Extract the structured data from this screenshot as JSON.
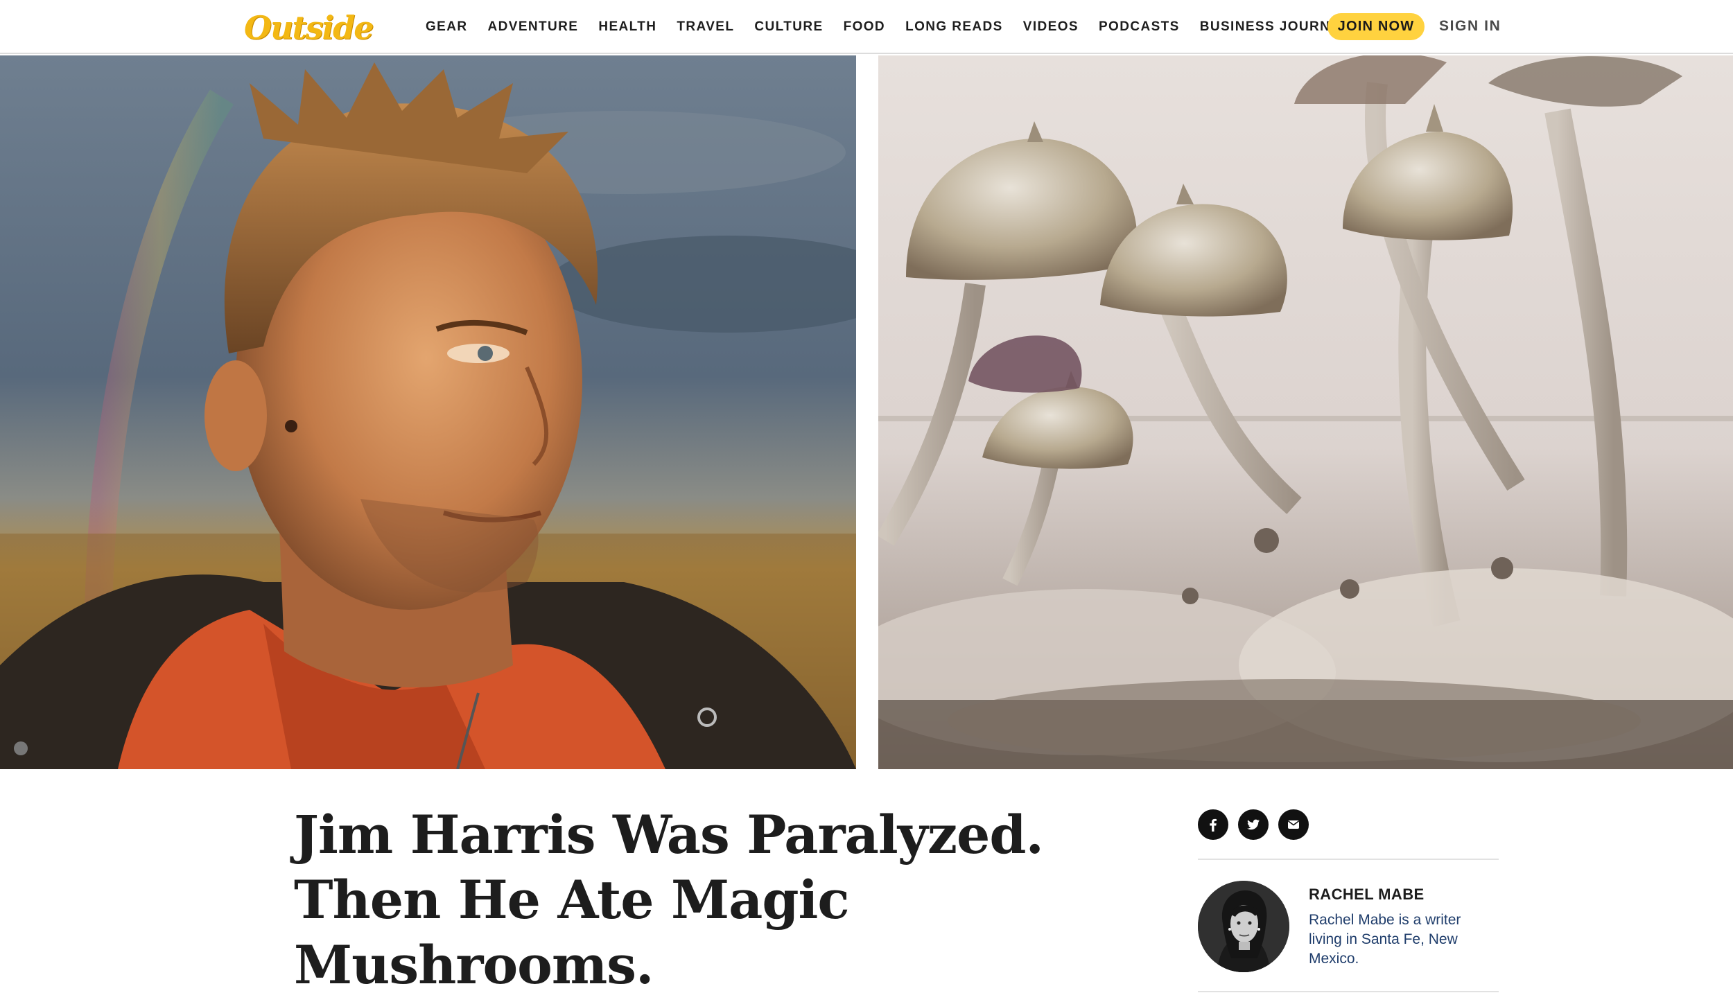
{
  "brand": {
    "logo_text": "Outside",
    "accent_color": "#ffd23f"
  },
  "nav": {
    "items": [
      "GEAR",
      "ADVENTURE",
      "HEALTH",
      "TRAVEL",
      "CULTURE",
      "FOOD",
      "LONG READS",
      "VIDEOS",
      "PODCASTS",
      "BUSINESS JOURNAL"
    ],
    "join_label": "JOIN NOW",
    "signin_label": "SIGN IN"
  },
  "hero": {
    "left_image": "portrait-of-man-in-orange-fleece",
    "right_image": "magic-mushrooms-closeup"
  },
  "article": {
    "headline": "Jim Harris Was Paralyzed. Then He Ate Magic Mushrooms."
  },
  "share": {
    "icons": [
      "facebook-icon",
      "twitter-icon",
      "email-icon"
    ]
  },
  "author": {
    "name": "RACHEL MABE",
    "bio": "Rachel Mabe is a writer living in Santa Fe, New Mexico."
  }
}
